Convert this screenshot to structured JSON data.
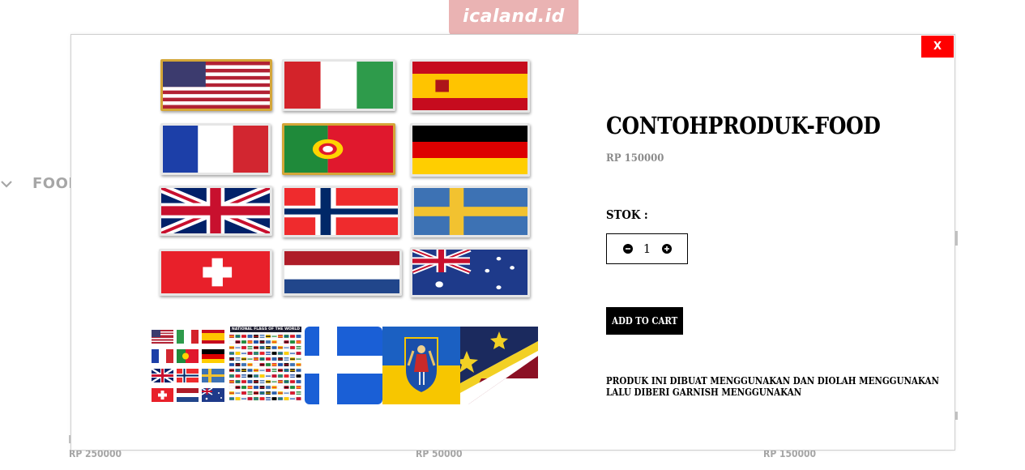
{
  "background": {
    "logo_text": "icaland.id",
    "category_label": "FOODS",
    "prices": [
      "RP 250000",
      "RP 50000",
      "RP 150000"
    ]
  },
  "modal": {
    "close_label": "X",
    "product": {
      "name": "CONTOHPRODUK-FOOD",
      "price": "RP 150000",
      "stock_label": "STOK :",
      "quantity": "1",
      "add_to_cart_label": "ADD TO CART",
      "description": "PRODUK INI DIBUAT MENGGUNAKAN DAN DIOLAH MENGGUNAKAN LALU DIBERI GARNISH MENGGUNAKAN"
    },
    "main_image": {
      "flags": [
        "usa",
        "italy",
        "spain",
        "france",
        "portugal",
        "germany",
        "uk",
        "norway",
        "sweden",
        "switzerland",
        "netherlands",
        "australia"
      ]
    },
    "thumbnails": [
      {
        "name": "flags-grid"
      },
      {
        "name": "national-flags-of-the-world",
        "caption": "NATIONAL FLAGS OF THE WORLD"
      },
      {
        "name": "blue-white-cross-flag"
      },
      {
        "name": "kyiv-coat-of-arms-flag"
      },
      {
        "name": "star-flag"
      }
    ]
  },
  "colors": {
    "close_bg": "#ff0000",
    "button_bg": "#000000",
    "price_text": "#8a8a8a",
    "logo_bg": "#e8a9a9"
  }
}
